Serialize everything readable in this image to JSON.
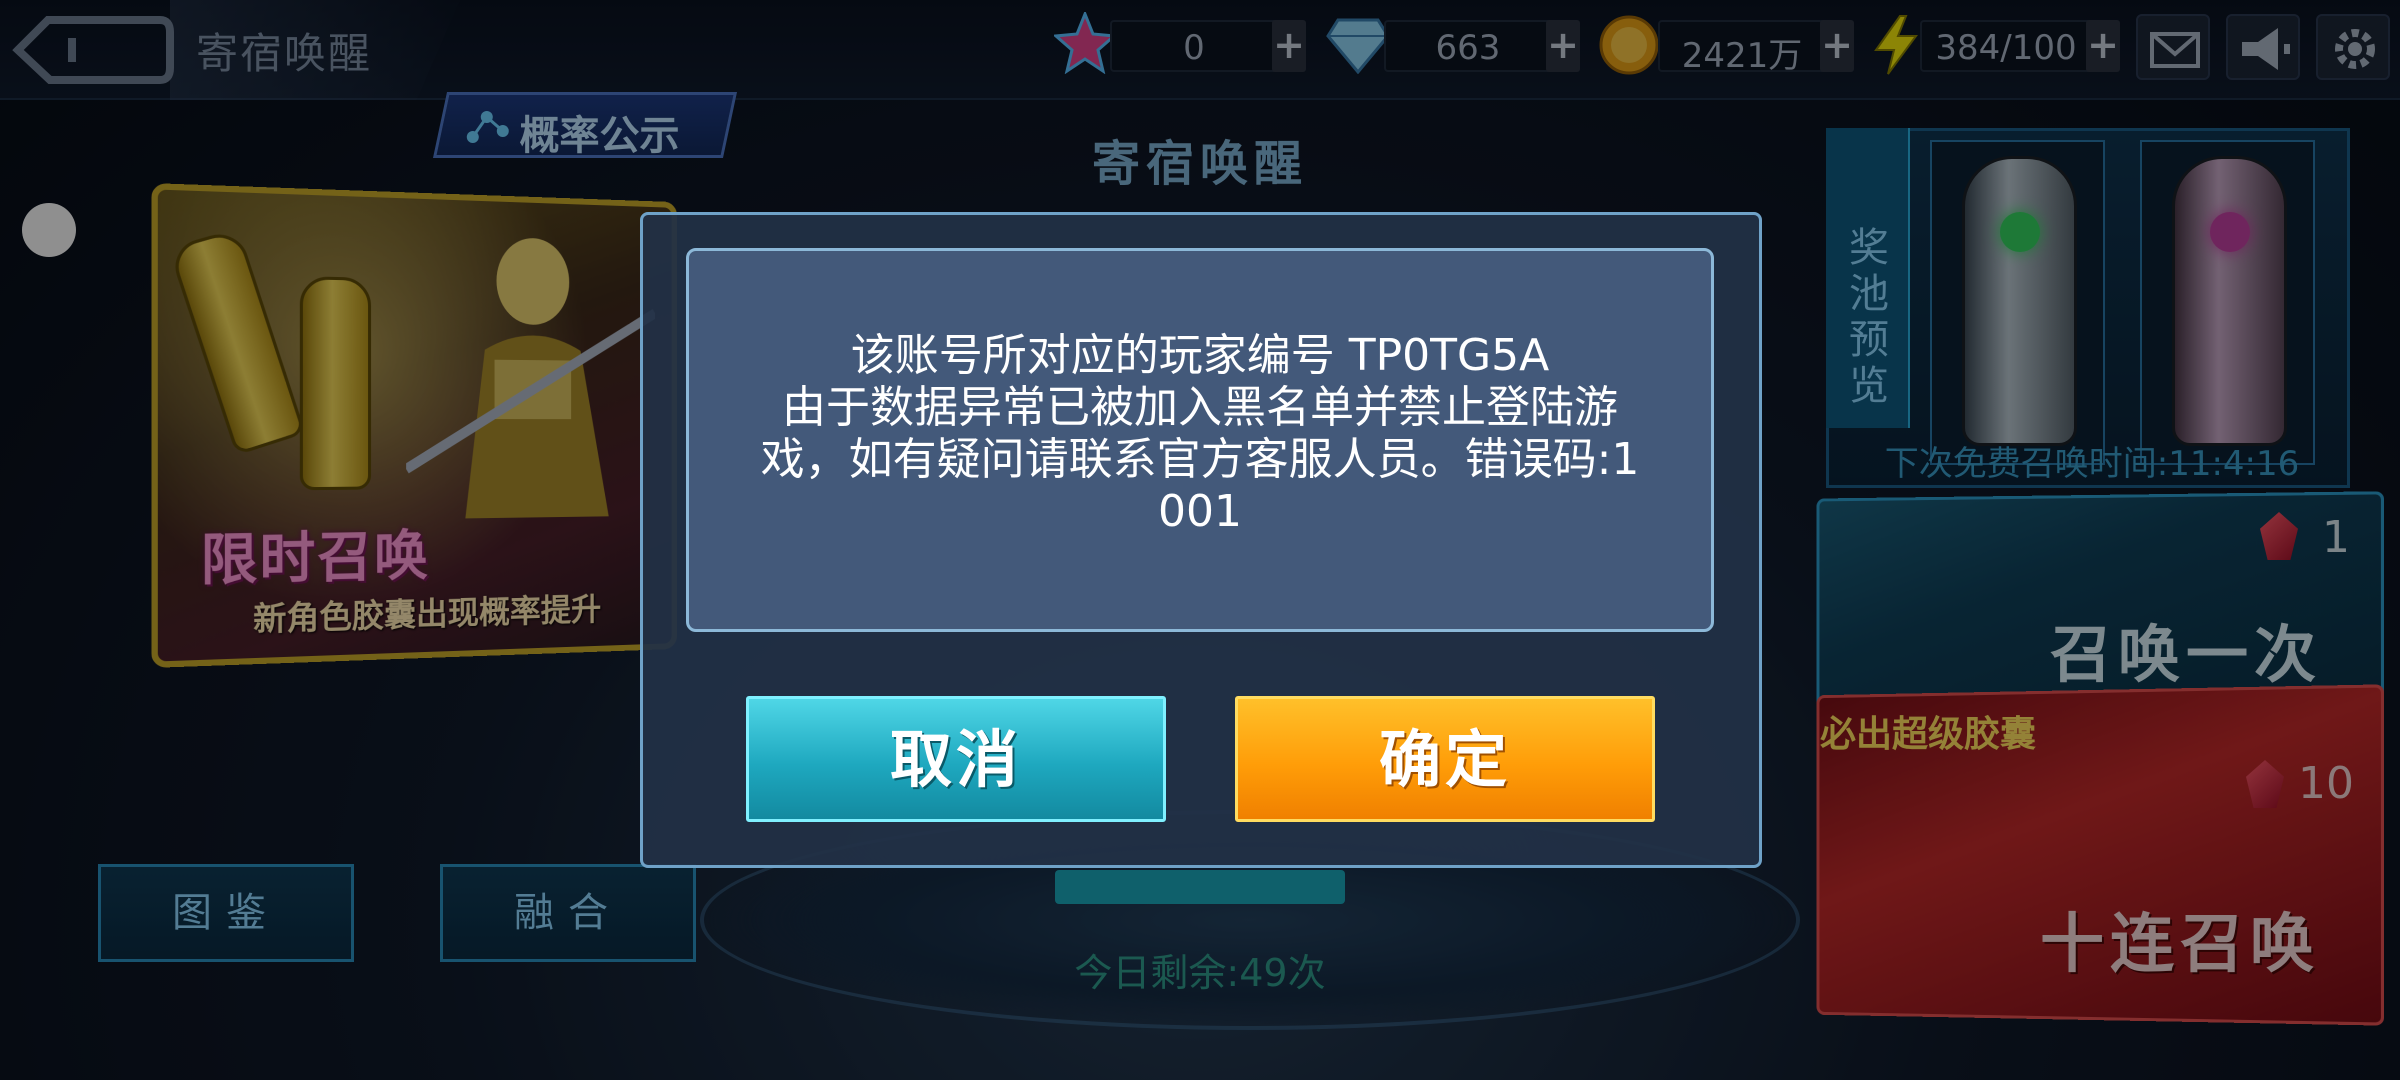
{
  "header": {
    "title": "寄宿唤醒",
    "resources": [
      {
        "icon": "star-icon",
        "value": "0"
      },
      {
        "icon": "diamond-icon",
        "value": "663"
      },
      {
        "icon": "coin-icon",
        "value": "2421万"
      },
      {
        "icon": "energy-icon",
        "value": "384/100"
      }
    ],
    "plus": "+",
    "buttons": [
      "mail-icon",
      "announcement-icon",
      "settings-icon"
    ]
  },
  "left": {
    "probability_label": "概率公示",
    "banner_title": "限时召唤",
    "banner_subtitle": "新角色胶囊出现概率提升",
    "collection_label": "图鉴",
    "fusion_label": "融合"
  },
  "center": {
    "title": "寄宿唤醒",
    "remaining": "今日剩余:49次"
  },
  "right": {
    "pool_label": "奖池预览",
    "free_time": "下次免费召唤时间:11:4:16",
    "summon_one_label": "召唤一次",
    "summon_one_cost": "1",
    "summon_ten_tag": "必出超级胶囊",
    "summon_ten_label": "十连召唤",
    "summon_ten_cost": "10"
  },
  "dialog": {
    "message_lines": [
      "该账号所对应的玩家编号 TP0TG5A",
      "由于数据异常已被加入黑名单并禁止登陆游",
      "戏，如有疑问请联系官方客服人员。错误码:1",
      "001"
    ],
    "cancel_label": "取消",
    "confirm_label": "确定"
  },
  "colors": {
    "cancel": "#1ea8bf",
    "confirm": "#ff9d08",
    "dialog_bg": "#43597a"
  }
}
